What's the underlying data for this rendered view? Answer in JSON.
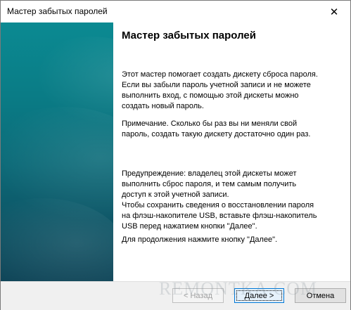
{
  "window": {
    "title": "Мастер забытых паролей",
    "close_icon": "close-icon"
  },
  "content": {
    "heading": "Мастер забытых паролей",
    "intro": "Этот мастер помогает создать дискету сброса пароля.\nЕсли вы забыли пароль учетной записи и не можете\nвыполнить вход, с помощью этой дискеты можно\nсоздать новый пароль.",
    "note": "Примечание. Сколько бы раз вы ни меняли свой\nпароль, создать такую дискету достаточно один раз.",
    "warning": "Предупреждение: владелец этой дискеты может\nвыполнить сброс пароля, и тем самым получить\nдоступ к этой учетной записи.\nЧтобы сохранить сведения о восстановлении пароля\nна флэш-накопителе USB, вставьте флэш-накопитель\nUSB перед нажатием кнопки \"Далее\".",
    "continue": "Для продолжения нажмите кнопку \"Далее\"."
  },
  "buttons": {
    "back": "< Назад",
    "next": "Далее >",
    "cancel": "Отмена"
  },
  "watermark": "REMONTKA.COM",
  "colors": {
    "side_panel_top": "#0b8a92",
    "side_panel_bottom": "#0f4558",
    "footer": "#f0f0f0",
    "default_button_border": "#0078d7"
  }
}
